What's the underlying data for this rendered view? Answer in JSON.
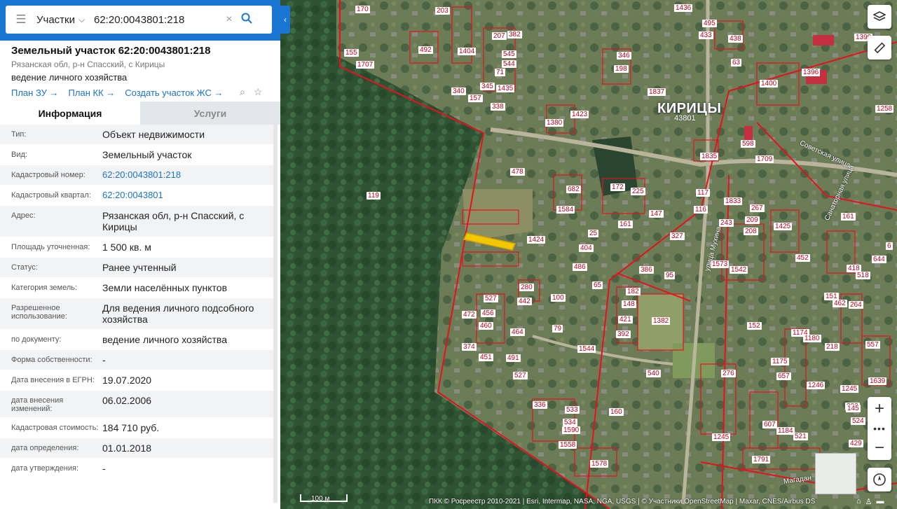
{
  "search": {
    "category": "Участки",
    "query": "62:20:0043801:218"
  },
  "object": {
    "title": "Земельный участок 62:20:0043801:218",
    "address_short": "Рязанская обл, р-н Спасский, с Кирицы",
    "use": "ведение личного хозяйства",
    "links": [
      "План ЗУ",
      "План КК",
      "Создать участок ЖС"
    ]
  },
  "tabs": {
    "info": "Информация",
    "services": "Услуги"
  },
  "info_rows": [
    {
      "k": "Тип:",
      "v": "Объект недвижимости"
    },
    {
      "k": "Вид:",
      "v": "Земельный участок"
    },
    {
      "k": "Кадастровый номер:",
      "v": "62:20:0043801:218"
    },
    {
      "k": "Кадастровый квартал:",
      "v": "62:20:0043801"
    },
    {
      "k": "Адрес:",
      "v": "Рязанская обл, р-н Спасский, с Кирицы"
    },
    {
      "k": "Площадь уточненная:",
      "v": "1 500 кв. м"
    },
    {
      "k": "Статус:",
      "v": "Ранее учтенный"
    },
    {
      "k": "Категория земель:",
      "v": "Земли населённых пунктов"
    },
    {
      "k": "Разрешенное использование:",
      "v": "Для ведения личного подсобного хозяйства"
    },
    {
      "k": "по документу:",
      "v": "ведение личного хозяйства"
    },
    {
      "k": "Форма собственности:",
      "v": "-"
    },
    {
      "k": "Дата внесения в ЕГРН:",
      "v": "19.07.2020"
    },
    {
      "k": "дата внесения изменений:",
      "v": "06.02.2006"
    },
    {
      "k": "Кадастровая стоимость:",
      "v": "184 710 руб."
    },
    {
      "k": "дата определения:",
      "v": "01.01.2018"
    },
    {
      "k": "дата утверждения:",
      "v": "-"
    }
  ],
  "map": {
    "place": "КИРИЦЫ",
    "quarter": "43801",
    "streets": [
      "Советская улица",
      "Санаторная улица",
      "улица Мухина",
      "Магадан"
    ],
    "scale": "100 м",
    "attribution": "ПКК © Росреестр 2010-2021 | Esri, Intermap, NASA, NGA, USGS | © Участники OpenStreetMap | Maxar, CNES/Airbus DS",
    "plot_numbers": [
      "170",
      "203",
      "1436",
      "495",
      "433",
      "438",
      "1399",
      "155",
      "1707",
      "492",
      "1404",
      "207",
      "382",
      "545",
      "544",
      "71",
      "346",
      "198",
      "63",
      "1396",
      "1400",
      "340",
      "157",
      "345",
      "1435",
      "338",
      "1837",
      "1423",
      "1380",
      "1258",
      "1835",
      "598",
      "1709",
      "478",
      "119",
      "682",
      "1584",
      "172",
      "225",
      "147",
      "117",
      "116",
      "1833",
      "267",
      "209",
      "208",
      "1425",
      "243",
      "327",
      "25",
      "404",
      "161",
      "1424",
      "486",
      "65",
      "386",
      "95",
      "1573",
      "1542",
      "452",
      "280",
      "442",
      "100",
      "527",
      "456",
      "460",
      "472",
      "464",
      "79",
      "182",
      "148",
      "421",
      "392",
      "1382",
      "152",
      "1174",
      "1180",
      "218",
      "557",
      "374",
      "451",
      "491",
      "527",
      "1544",
      "540",
      "1175",
      "657",
      "1246",
      "1245",
      "322",
      "160",
      "336",
      "533",
      "534",
      "1590",
      "1558",
      "1578",
      "276",
      "607",
      "1184",
      "521",
      "1791",
      "1639",
      "1245",
      "145",
      "429",
      "524",
      "151",
      "462",
      "264",
      "418",
      "518",
      "644",
      "6",
      "161"
    ]
  }
}
